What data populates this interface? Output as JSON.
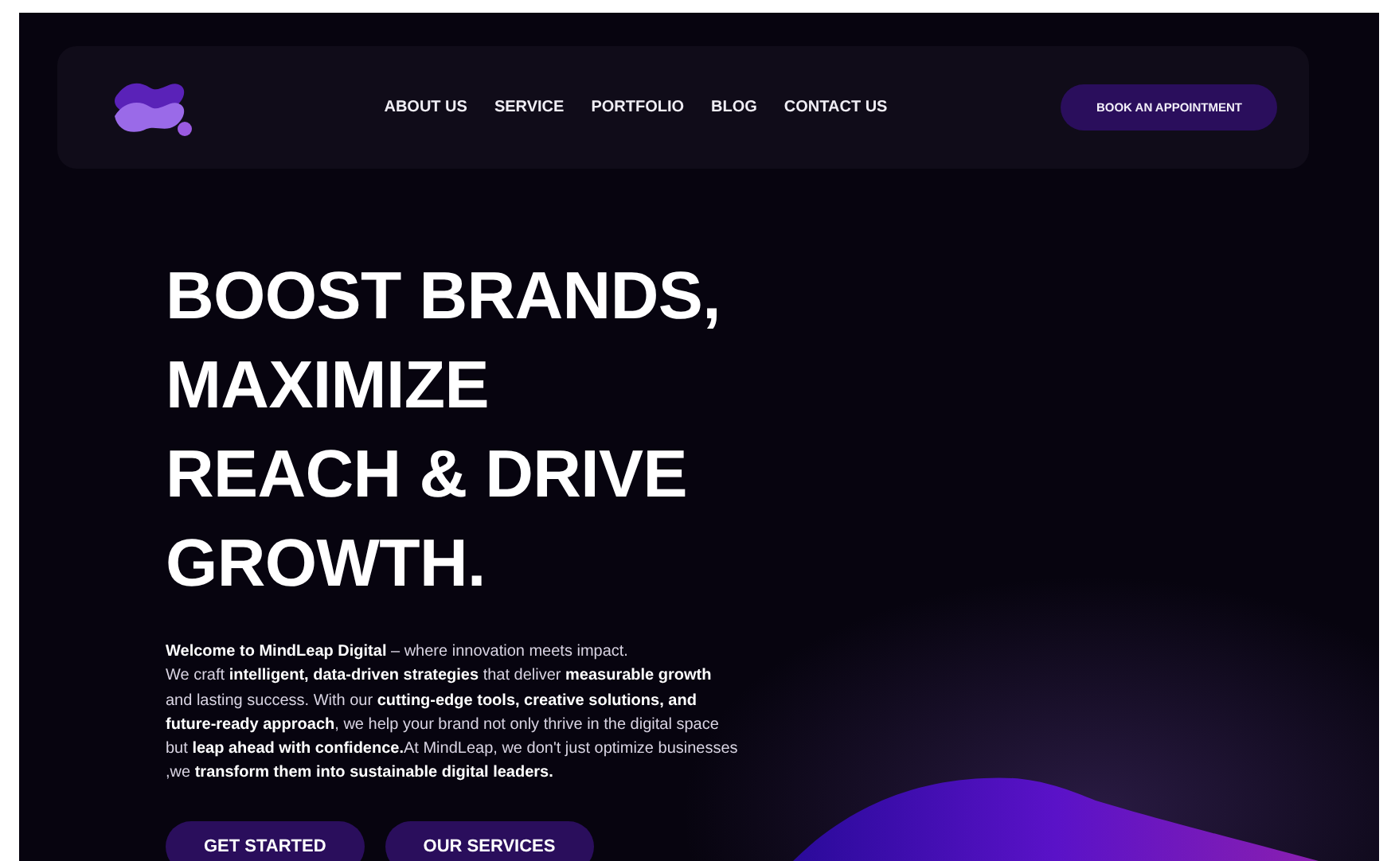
{
  "nav": {
    "links": [
      "ABOUT US",
      "SERVICE",
      "PORTFOLIO",
      "BLOG",
      "CONTACT US"
    ],
    "cta": "BOOK AN APPOINTMENT"
  },
  "hero": {
    "heading": "BOOST BRANDS,\nMAXIMIZE\nREACH & DRIVE\nGROWTH.",
    "intro": "**Welcome to MindLeap Digital** – where innovation meets impact.\nWe craft **intelligent, data-driven strategies** that deliver **measurable growth** and lasting success. With our **cutting-edge tools, creative solutions, and future-ready approach**, we help your brand not only thrive in the digital space but **leap ahead with confidence.**At MindLeap, we don't just optimize businesses ,we **transform them into sustainable digital leaders.**",
    "buttons": [
      "GET STARTED",
      "OUR SERVICES"
    ]
  }
}
